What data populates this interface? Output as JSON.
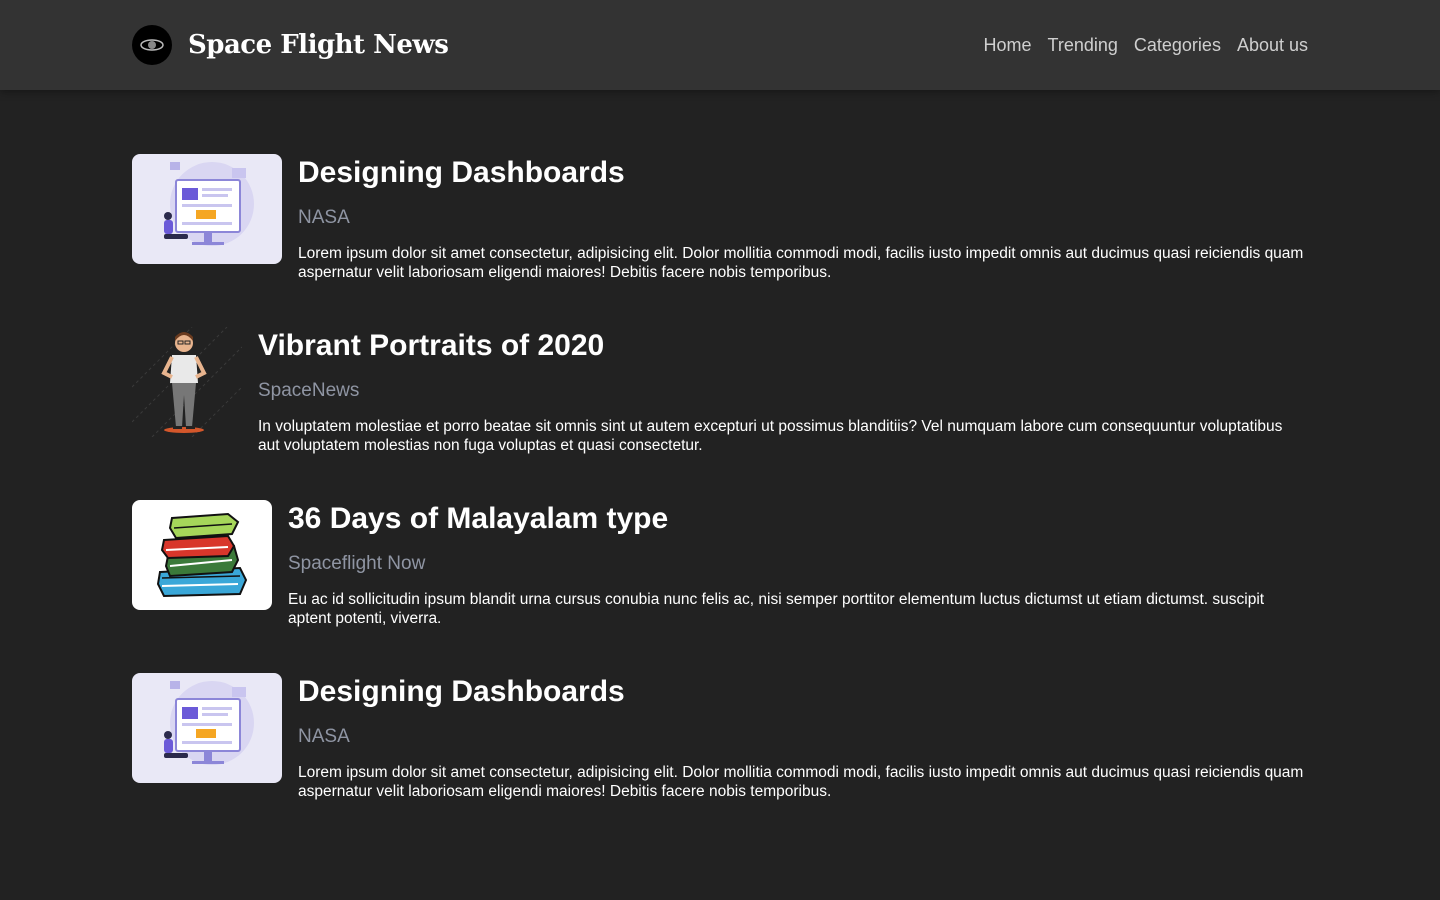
{
  "header": {
    "brand": "Space Flight News",
    "nav": [
      "Home",
      "Trending",
      "Categories",
      "About us"
    ]
  },
  "articles": [
    {
      "title": "Designing Dashboards",
      "source": "NASA",
      "description": "Lorem ipsum dolor sit amet consectetur, adipisicing elit. Dolor mollitia commodi modi, facilis iusto impedit omnis aut ducimus quasi reiciendis quam aspernatur velit laboriosam eligendi maiores! Debitis facere nobis temporibus."
    },
    {
      "title": "Vibrant Portraits of 2020",
      "source": "SpaceNews",
      "description": "In voluptatem molestiae et porro beatae sit omnis sint ut autem excepturi ut possimus blanditiis? Vel numquam labore cum consequuntur voluptatibus aut voluptatem molestias non fuga voluptas et quasi consectetur."
    },
    {
      "title": "36 Days of Malayalam type",
      "source": "Spaceflight Now",
      "description": "Eu ac id sollicitudin ipsum blandit urna cursus conubia nunc felis ac, nisi semper porttitor elementum luctus dictumst ut etiam dictumst. suscipit aptent potenti, viverra."
    },
    {
      "title": "Designing Dashboards",
      "source": "NASA",
      "description": "Lorem ipsum dolor sit amet consectetur, adipisicing elit. Dolor mollitia commodi modi, facilis iusto impedit omnis aut ducimus quasi reiciendis quam aspernatur velit laboriosam eligendi maiores! Debitis facere nobis temporibus."
    }
  ],
  "colors": {
    "background": "#222222",
    "header": "#333333",
    "source_text": "#8f95a3",
    "nav_text": "#cfcfcf"
  }
}
